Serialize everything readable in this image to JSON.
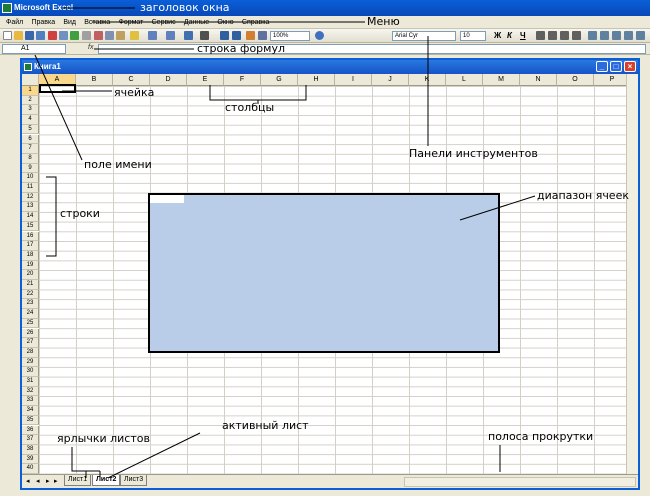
{
  "app": {
    "title": "Microsoft Excel"
  },
  "menu": [
    "Файл",
    "Правка",
    "Вид",
    "Вставка",
    "Формат",
    "Сервис",
    "Данные",
    "Окно",
    "Справка"
  ],
  "toolbar": {
    "zoom": "100%",
    "font": "Arial Cyr",
    "size": "10",
    "bold": "Ж",
    "italic": "К",
    "underline": "Ч"
  },
  "formula": {
    "name_box": "A1",
    "fx": "fx"
  },
  "workbook": {
    "title": "Книга1"
  },
  "columns": [
    "A",
    "B",
    "C",
    "D",
    "E",
    "F",
    "G",
    "H",
    "I",
    "J",
    "K",
    "L",
    "M",
    "N",
    "O",
    "P"
  ],
  "rows": [
    "1",
    "2",
    "3",
    "4",
    "5",
    "6",
    "7",
    "8",
    "9",
    "10",
    "11",
    "12",
    "13",
    "14",
    "15",
    "16",
    "17",
    "18",
    "19",
    "20",
    "21",
    "22",
    "23",
    "24",
    "25",
    "26",
    "27",
    "28",
    "29",
    "30",
    "31",
    "32",
    "33",
    "34",
    "35",
    "36",
    "37",
    "38",
    "39",
    "40"
  ],
  "sheets": [
    "Лист1",
    "Лист2",
    "Лист3"
  ],
  "annotations": {
    "window_title": "заголовок окна",
    "menu": "Меню",
    "formula_bar": "строка формул",
    "cell": "ячейка",
    "columns": "столбцы",
    "name_field": "поле имени",
    "toolbars": "Панели инструментов",
    "rows": "строки",
    "cell_range": "диапазон ячеек",
    "sheet_tabs": "ярлычки листов",
    "active_sheet": "активный лист",
    "scrollbar": "полоса прокрутки"
  }
}
